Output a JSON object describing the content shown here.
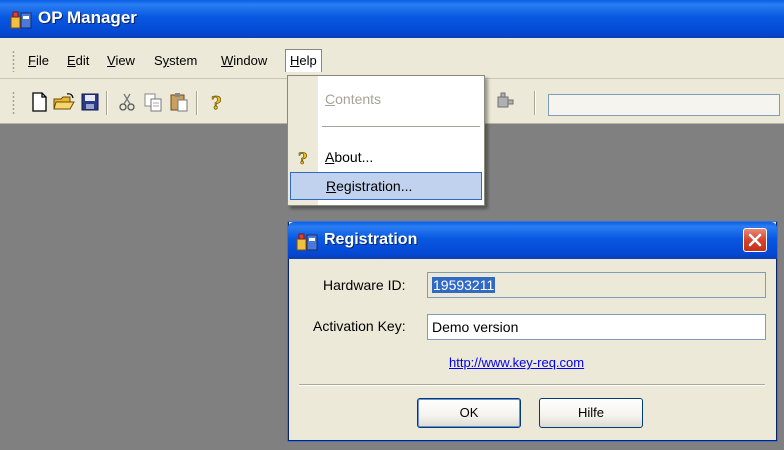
{
  "app": {
    "title": "OP Manager",
    "icon": "app-icon"
  },
  "menubar": {
    "items": [
      {
        "label": "File",
        "mnemonic": "F"
      },
      {
        "label": "Edit",
        "mnemonic": "E"
      },
      {
        "label": "View",
        "mnemonic": "V"
      },
      {
        "label": "System",
        "mnemonic": "y"
      },
      {
        "label": "Window",
        "mnemonic": "W"
      },
      {
        "label": "Help",
        "mnemonic": "H",
        "open": true
      }
    ]
  },
  "toolbar": {
    "buttons": [
      "new-document-icon",
      "open-folder-icon",
      "save-icon",
      "cut-icon",
      "copy-icon",
      "paste-icon",
      "help-icon",
      "plugin-icon"
    ]
  },
  "help_menu": {
    "items": [
      {
        "label": "Contents",
        "mnemonic": "C",
        "enabled": false
      },
      {
        "label": "About...",
        "mnemonic": "A",
        "enabled": true,
        "icon": "help-question-icon"
      },
      {
        "label": "Registration...",
        "mnemonic": "R",
        "enabled": true,
        "highlighted": true
      }
    ]
  },
  "registration_dialog": {
    "title": "Registration",
    "hardware_id_label": "Hardware ID:",
    "hardware_id_value": "19593211",
    "activation_key_label": "Activation Key:",
    "activation_key_value": "Demo version",
    "link": "http://www.key-req.com",
    "ok_label": "OK",
    "ok_mnemonic": "O",
    "help_label": "Hilfe"
  },
  "colors": {
    "titlebar": "#0858e0",
    "workspace": "#808080",
    "menu_highlight": "#c1d2ee",
    "dialog_face": "#ece9d8",
    "close_button": "#d6432a"
  }
}
